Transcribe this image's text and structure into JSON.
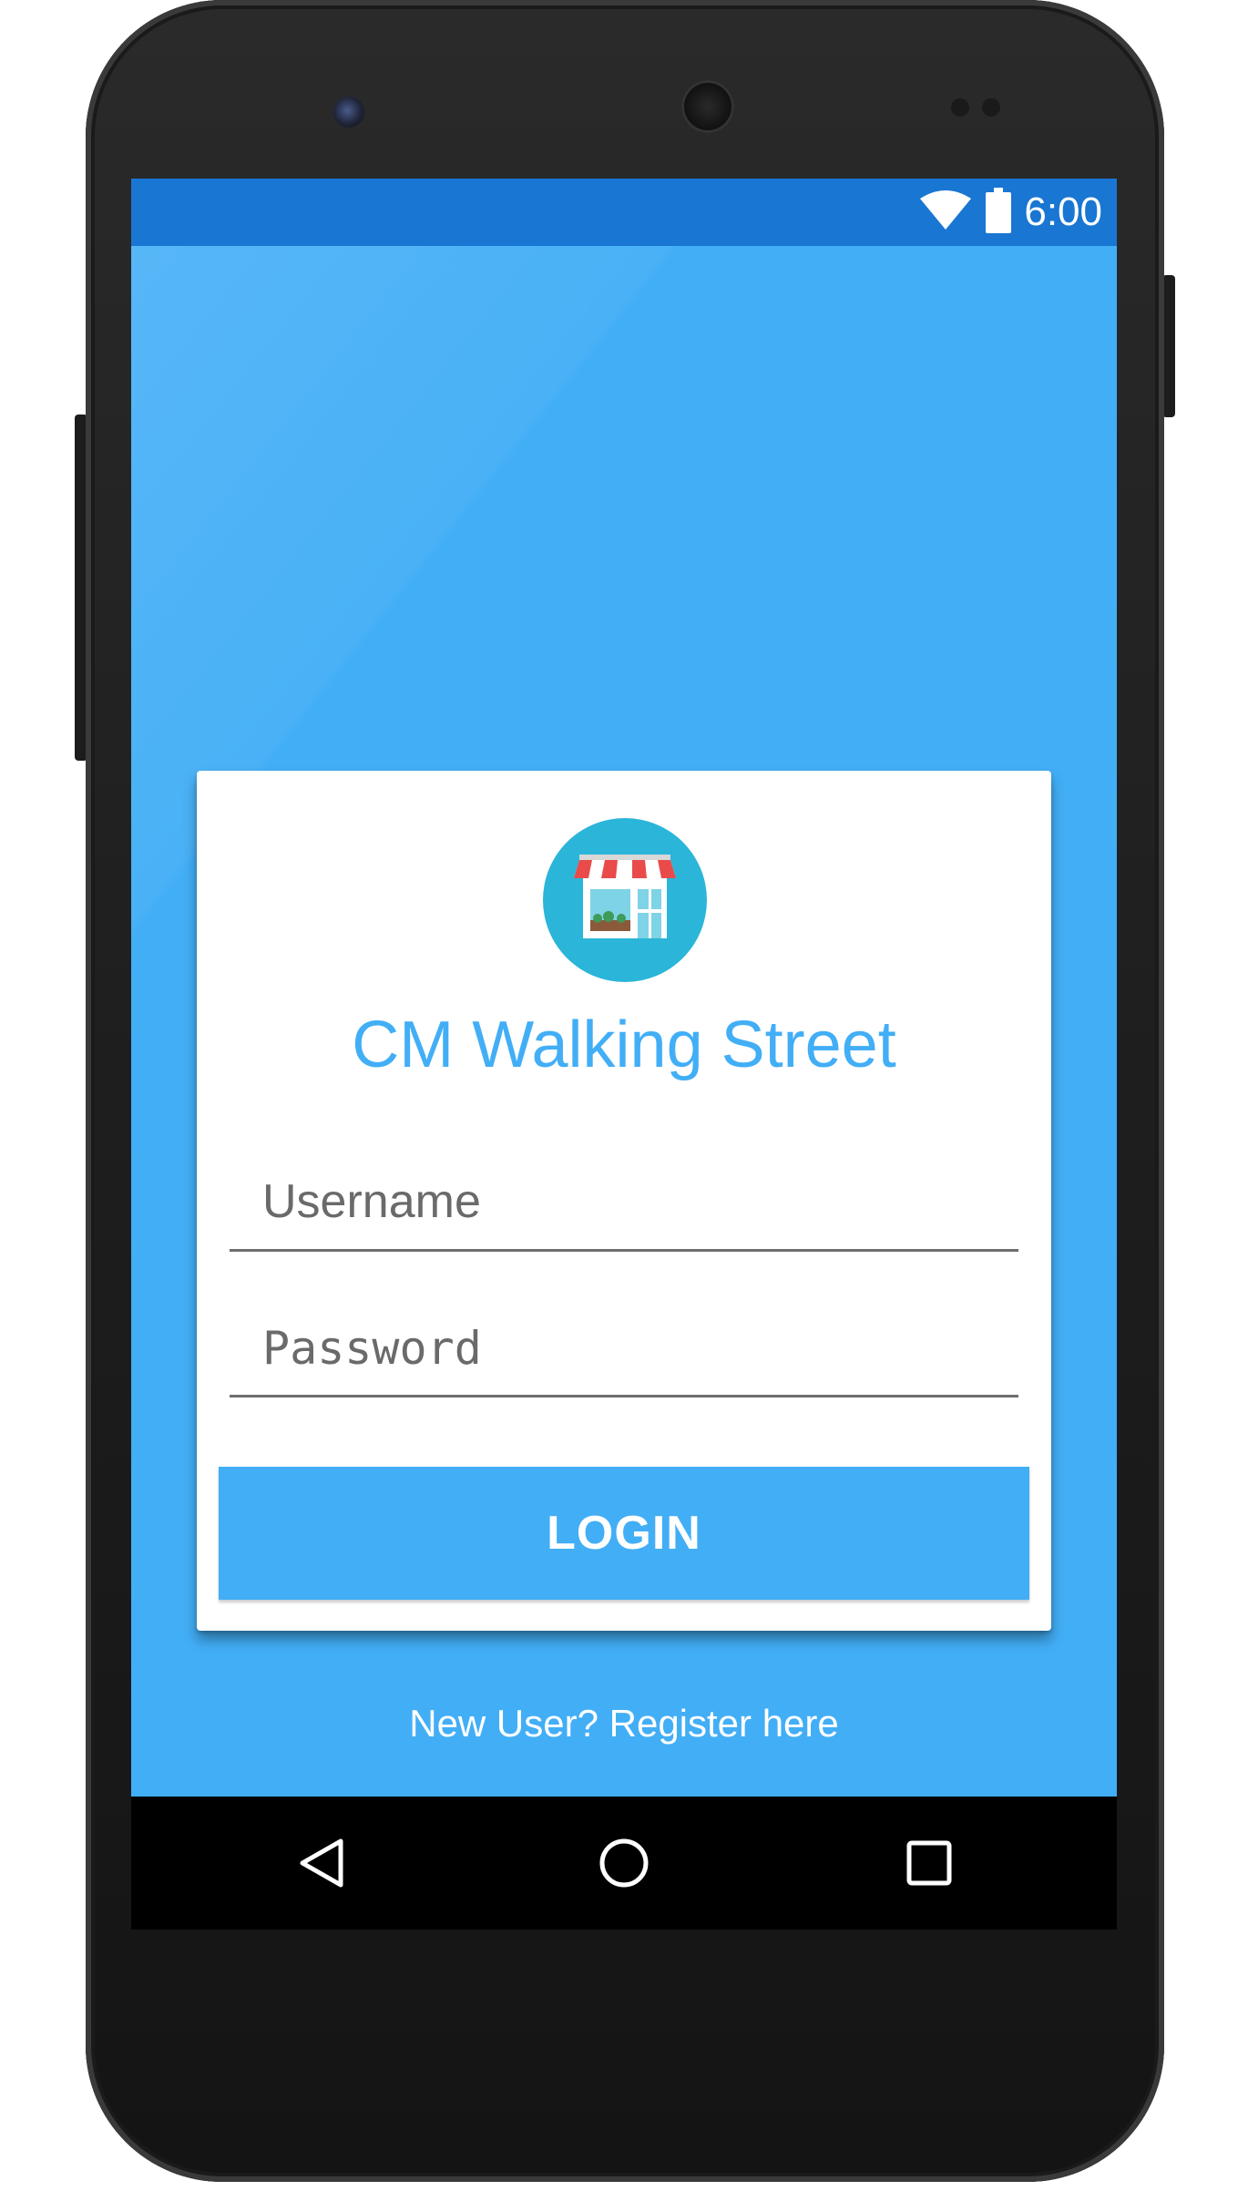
{
  "status_bar": {
    "time": "6:00",
    "icons": [
      "wifi-icon",
      "battery-icon"
    ],
    "color": "#1976d2"
  },
  "login_card": {
    "logo_icon": "storefront-icon",
    "app_title": "CM Walking Street",
    "username": {
      "placeholder": "Username",
      "value": ""
    },
    "password": {
      "placeholder": "Password",
      "value": ""
    },
    "login_label": "LOGIN"
  },
  "register_link": "New User? Register here",
  "nav_bar": {
    "icons": [
      "back-icon",
      "home-icon",
      "recents-icon"
    ]
  },
  "colors": {
    "background": "#42aef6",
    "accent": "#42aef6",
    "card": "#ffffff",
    "logo_circle": "#2ab5d9"
  }
}
